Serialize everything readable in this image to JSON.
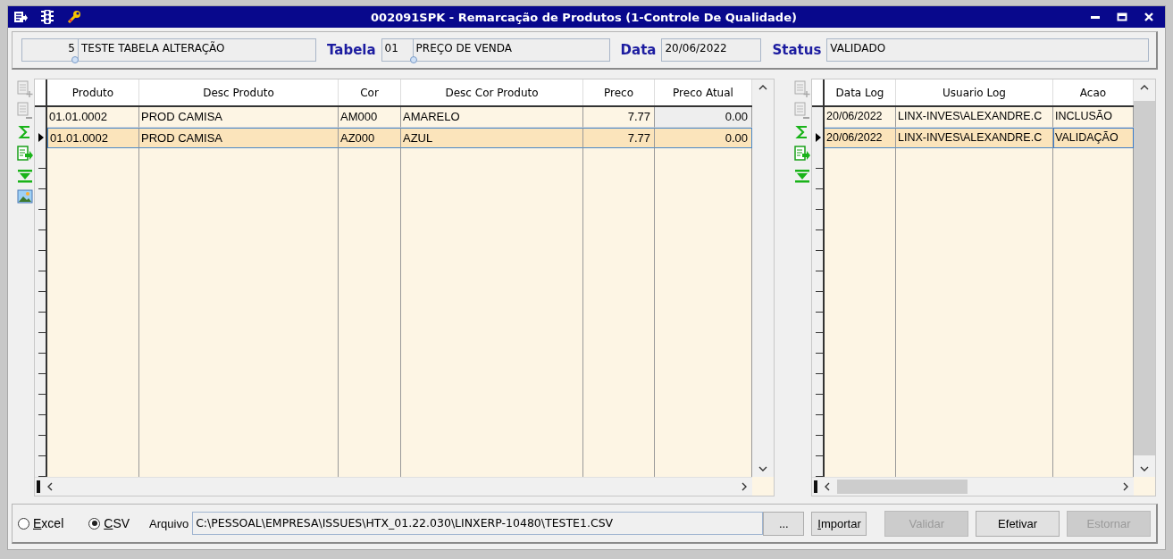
{
  "window": {
    "title": "002091SPK - Remarcação de Produtos (1-Controle De Qualidade)"
  },
  "header": {
    "table_code": "5",
    "table_name": "TESTE TABELA ALTERAÇÃO",
    "tabela_label": "Tabela",
    "tabela_code": "01",
    "tabela_name": "PREÇO DE VENDA",
    "data_label": "Data",
    "data_value": "20/06/2022",
    "status_label": "Status",
    "status_value": "VALIDADO"
  },
  "products_table": {
    "columns": [
      {
        "label": "Produto",
        "numeric": false
      },
      {
        "label": "Desc Produto",
        "numeric": false
      },
      {
        "label": "Cor",
        "numeric": false
      },
      {
        "label": "Desc Cor Produto",
        "numeric": false
      },
      {
        "label": "Preco",
        "numeric": true
      },
      {
        "label": "Preco Atual",
        "numeric": true
      }
    ],
    "rows": [
      {
        "selected": false,
        "cells": [
          "01.01.0002",
          "PROD CAMISA",
          "AM000",
          "AMARELO",
          "7.77",
          "0.00"
        ]
      },
      {
        "selected": true,
        "cells": [
          "01.01.0002",
          "PROD CAMISA",
          "AZ000",
          "AZUL",
          "7.77",
          "0.00"
        ]
      }
    ]
  },
  "log_table": {
    "columns": [
      {
        "label": "Data Log",
        "numeric": false
      },
      {
        "label": "Usuario Log",
        "numeric": false
      },
      {
        "label": "Acao",
        "numeric": false
      }
    ],
    "rows": [
      {
        "selected": false,
        "cells": [
          "20/06/2022",
          "LINX-INVES\\ALEXANDRE.C",
          "INCLUSÃO"
        ]
      },
      {
        "selected": true,
        "cells": [
          "20/06/2022",
          "LINX-INVES\\ALEXANDRE.C",
          "VALIDAÇÃO"
        ]
      }
    ]
  },
  "footer": {
    "formats": [
      {
        "label": "Excel",
        "selected": false,
        "underline_first": true
      },
      {
        "label": "CSV",
        "selected": true,
        "underline_first": true
      }
    ],
    "arquivo_label": "Arquivo",
    "arquivo_value": "C:\\PESSOAL\\EMPRESA\\ISSUES\\HTX_01.22.030\\LINXERP-10480\\TESTE1.CSV",
    "browse_label": "...",
    "buttons": [
      {
        "label": "Importar",
        "disabled": false,
        "underline_first": true
      },
      {
        "label": "Validar",
        "disabled": true,
        "underline_first": false
      },
      {
        "label": "Efetivar",
        "disabled": false,
        "underline_first": false
      },
      {
        "label": "Estornar",
        "disabled": true,
        "underline_first": false
      }
    ]
  }
}
